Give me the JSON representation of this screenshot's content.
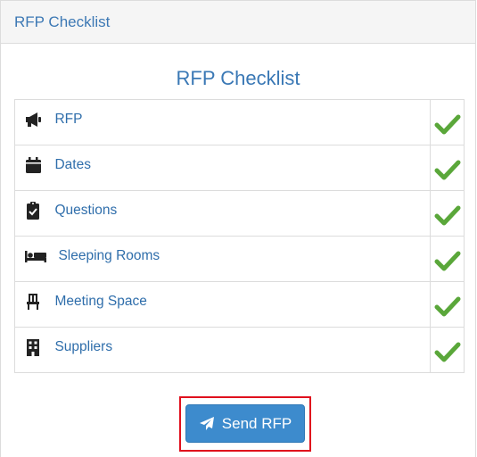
{
  "header": {
    "title": "RFP Checklist"
  },
  "main": {
    "title": "RFP Checklist"
  },
  "checklist": {
    "items": [
      {
        "label": "RFP",
        "icon": "megaphone-icon",
        "status": "complete"
      },
      {
        "label": "Dates",
        "icon": "calendar-icon",
        "status": "complete"
      },
      {
        "label": "Questions",
        "icon": "clipboard-check-icon",
        "status": "complete"
      },
      {
        "label": "Sleeping Rooms",
        "icon": "bed-icon",
        "status": "complete"
      },
      {
        "label": "Meeting Space",
        "icon": "chair-icon",
        "status": "complete"
      },
      {
        "label": "Suppliers",
        "icon": "building-icon",
        "status": "complete"
      }
    ]
  },
  "actions": {
    "send_label": "Send RFP",
    "send_icon": "paper-plane-icon"
  },
  "colors": {
    "accent": "#3d8bcd",
    "link": "#2f6eab",
    "check": "#5aa73a",
    "highlight_border": "#e0101d"
  }
}
